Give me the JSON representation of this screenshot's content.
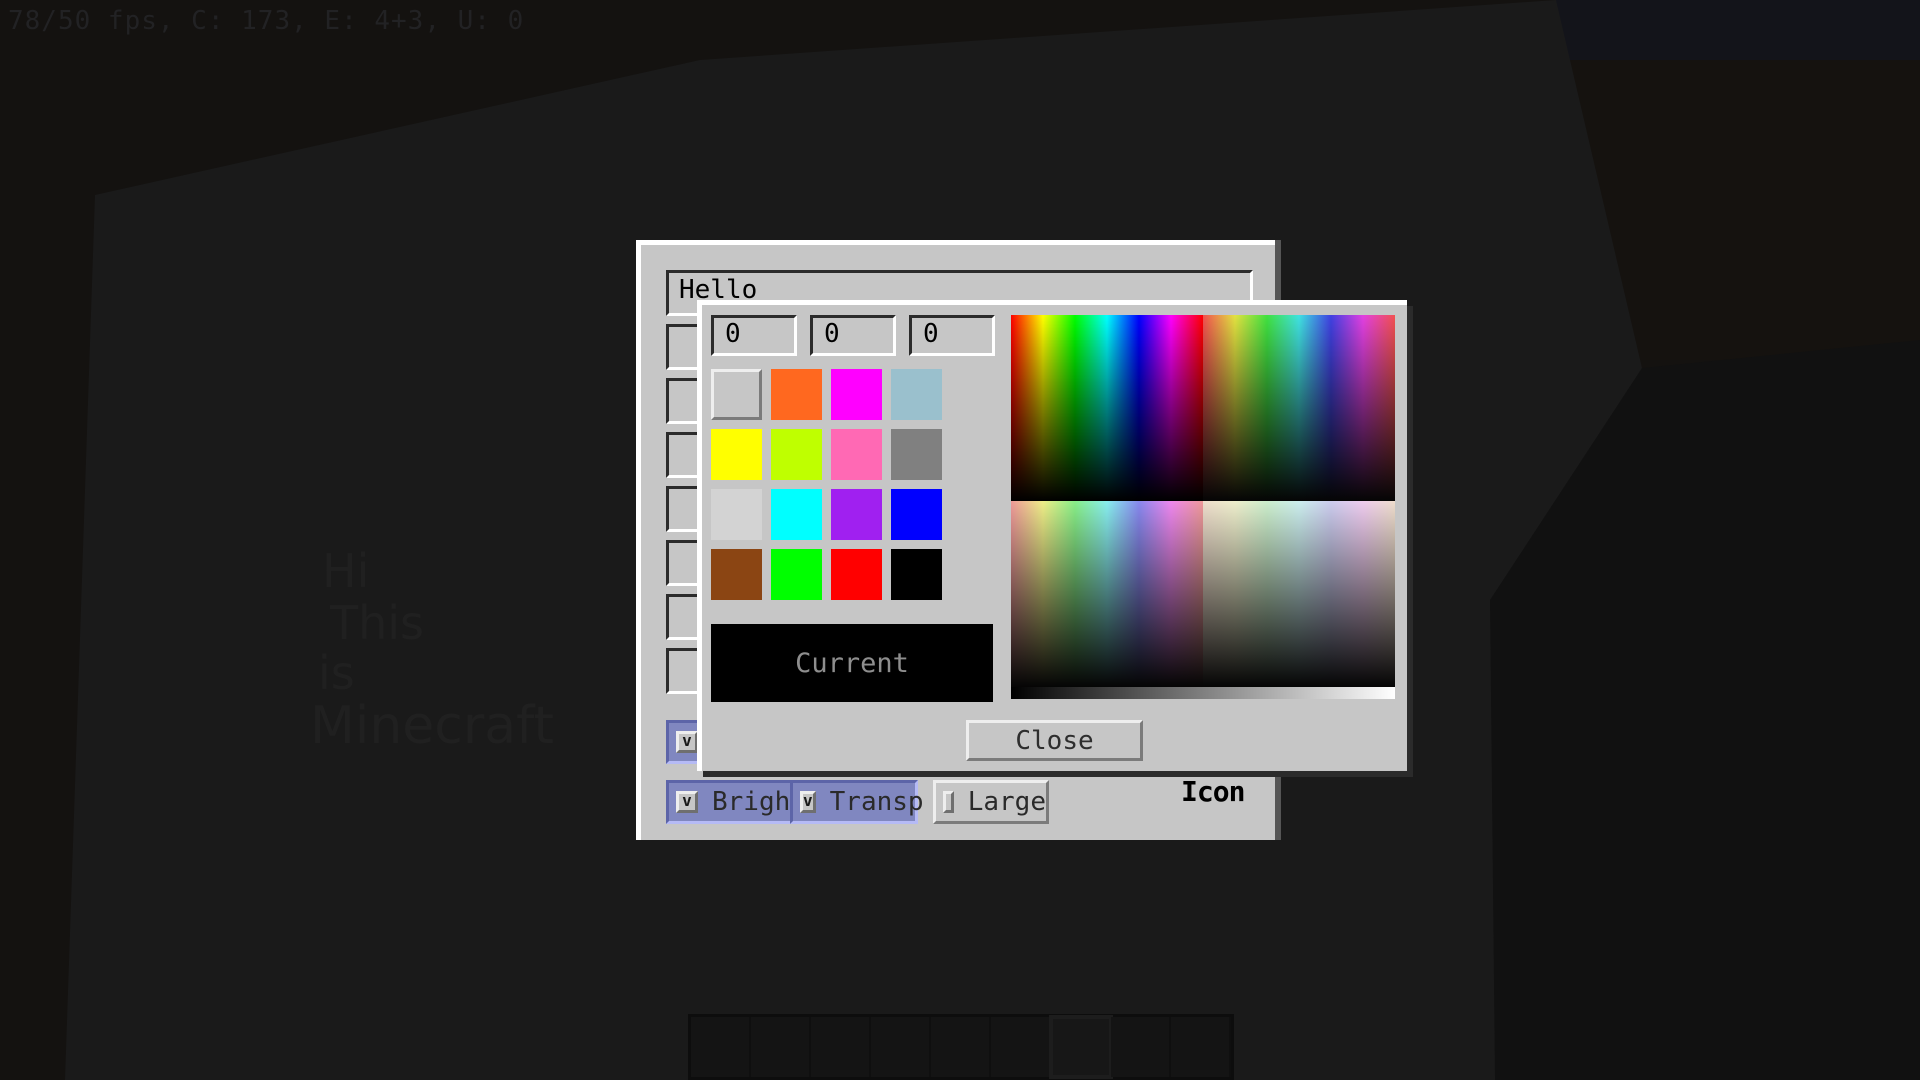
{
  "debug_overlay": "78/50 fps, C: 173, E: 4+3, U: 0",
  "sign_lines": [
    "Hi",
    "This",
    "is",
    "Minecraft"
  ],
  "hotbar": {
    "slot_count": 9,
    "selected_slot": 7
  },
  "editor": {
    "title_field": {
      "value": "Hello"
    },
    "text_fields": [
      "",
      "",
      "",
      "",
      "",
      "",
      ""
    ],
    "hidden_toggle": {
      "checked": true,
      "check_glyph": "v"
    },
    "toggles": [
      {
        "label": "Bright",
        "checked": true,
        "check_glyph": "v"
      },
      {
        "label": "Transp",
        "checked": true,
        "check_glyph": "v"
      },
      {
        "label": "Large",
        "checked": false,
        "check_glyph": ""
      }
    ],
    "icon_label": "Icon"
  },
  "color_picker": {
    "rgb": {
      "r": "0",
      "g": "0",
      "b": "0"
    },
    "swatches": [
      {
        "name": "default",
        "color": "#c6c6c6",
        "selected": true
      },
      {
        "name": "orange",
        "color": "#ff681f"
      },
      {
        "name": "magenta",
        "color": "#ff00ff"
      },
      {
        "name": "light-blue",
        "color": "#9ac0cd"
      },
      {
        "name": "yellow",
        "color": "#ffff00"
      },
      {
        "name": "lime",
        "color": "#bfff00"
      },
      {
        "name": "pink",
        "color": "#ff69b4"
      },
      {
        "name": "gray",
        "color": "#808080"
      },
      {
        "name": "light-gray",
        "color": "#d3d3d3"
      },
      {
        "name": "cyan",
        "color": "#00ffff"
      },
      {
        "name": "purple",
        "color": "#a020f0"
      },
      {
        "name": "blue",
        "color": "#0000ff"
      },
      {
        "name": "brown",
        "color": "#8b4513"
      },
      {
        "name": "green",
        "color": "#00ff00"
      },
      {
        "name": "red",
        "color": "#ff0000"
      },
      {
        "name": "black",
        "color": "#000000"
      }
    ],
    "current_label": "Current",
    "current_color": "#000000",
    "close_label": "Close"
  }
}
